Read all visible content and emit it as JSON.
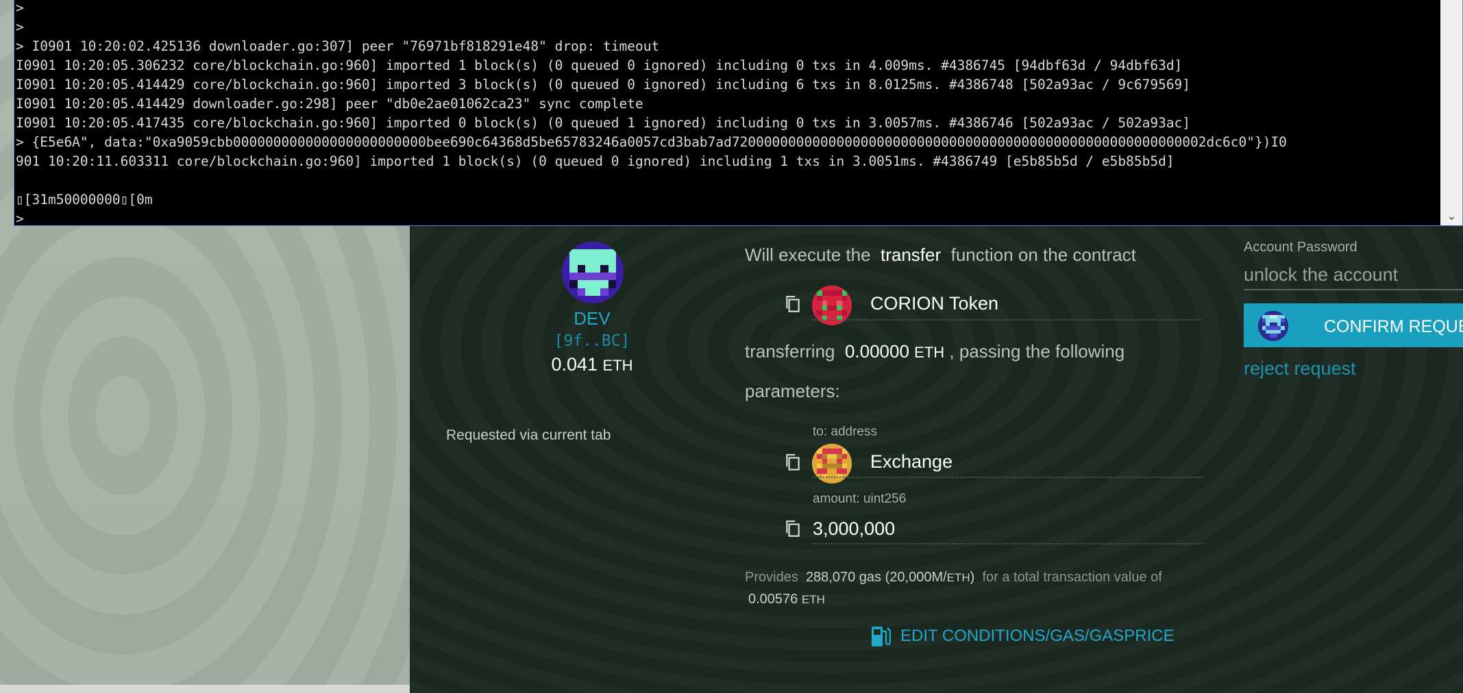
{
  "terminal": {
    "lines": [
      ">",
      ">",
      "> I0901 10:20:02.425136 downloader.go:307] peer \"76971bf818291e48\" drop: timeout",
      "I0901 10:20:05.306232 core/blockchain.go:960] imported 1 block(s) (0 queued 0 ignored) including 0 txs in 4.009ms. #4386745 [94dbf63d / 94dbf63d]",
      "I0901 10:20:05.414429 core/blockchain.go:960] imported 3 block(s) (0 queued 0 ignored) including 6 txs in 8.0125ms. #4386748 [502a93ac / 9c679569]",
      "I0901 10:20:05.414429 downloader.go:298] peer \"db0e2ae01062ca23\" sync complete",
      "I0901 10:20:05.417435 core/blockchain.go:960] imported 0 block(s) (0 queued 1 ignored) including 0 txs in 3.0057ms. #4386746 [502a93ac / 502a93ac]",
      "> {E5e6A\", data:\"0xa9059cbb000000000000000000000000bee690c64368d5be65783246a0057cd3bab7ad72000000000000000000000000000000000000000000000000000000002dc6c0\"})I0",
      "901 10:20:11.603311 core/blockchain.go:960] imported 1 block(s) (0 queued 0 ignored) including 1 txs in 3.0051ms. #4386749 [e5b85b5d / e5b85b5d]",
      "",
      "\u001b[31m50000000\u001b[0m",
      ">"
    ],
    "scroll_icon": "chevron-down-icon"
  },
  "from": {
    "name": "DEV",
    "address": "[9f..BC]",
    "balance": "0.041",
    "unit": "ETH"
  },
  "requested_via": "Requested via current tab",
  "execute": {
    "prefix": "Will execute the",
    "function": "transfer",
    "suffix": "function on the contract"
  },
  "contract": {
    "name": "CORION Token"
  },
  "transferring": {
    "prefix": "transferring",
    "amount": "0.00000",
    "unit": "ETH",
    "suffix": ", passing the following",
    "line2": "parameters:"
  },
  "params": [
    {
      "label": "to: address",
      "value": "Exchange"
    },
    {
      "label": "amount: uint256",
      "value": "3,000,000"
    }
  ],
  "gas": {
    "provides_prefix": "Provides",
    "gas_amount": "288,070 gas",
    "gas_price": "(20,000M/",
    "gas_price_unit": "ETH",
    "gas_price_close": ")",
    "suffix": "for a total transaction value of",
    "total": "0.00576",
    "total_unit": "ETH",
    "edit_label": "EDIT CONDITIONS/GAS/GASPRICE",
    "edit_icon": "gas-pump-icon"
  },
  "form": {
    "password_label": "Account Password",
    "password_placeholder": "unlock the account",
    "confirm_label": "CONFIRM REQUEST",
    "reject_label": "reject request"
  },
  "colors": {
    "accent": "#22a6c9",
    "panel_bg": "#1c2a21",
    "terminal_bg": "#000000",
    "confirm_bg": "#1aa0bf"
  }
}
